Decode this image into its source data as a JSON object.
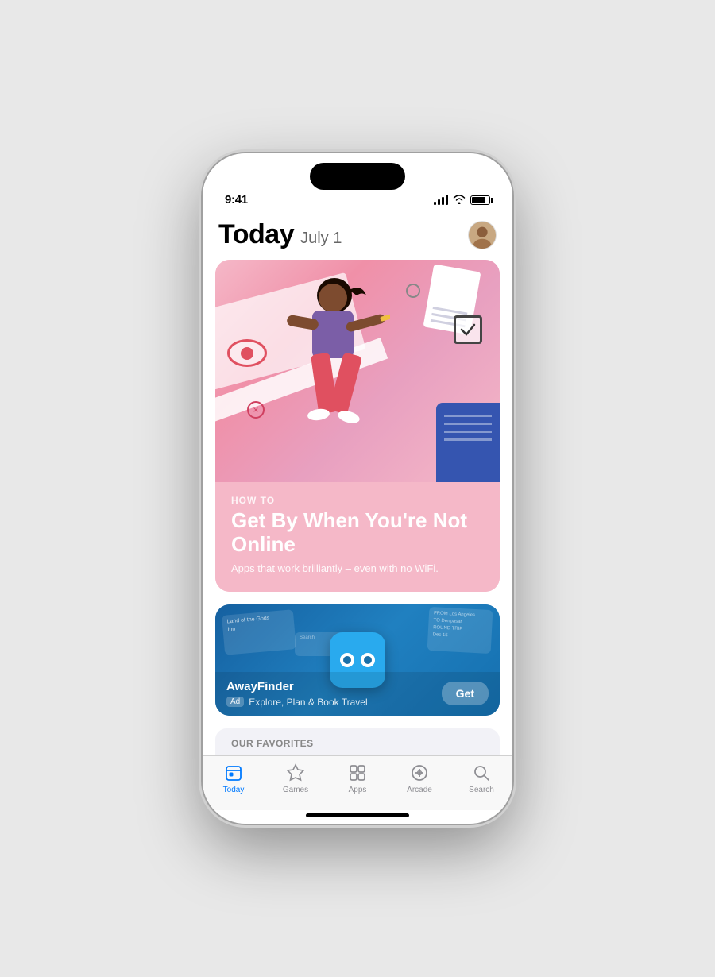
{
  "phone": {
    "status_bar": {
      "time": "9:41",
      "signal_label": "signal bars",
      "wifi_label": "wifi",
      "battery_label": "battery"
    },
    "header": {
      "title": "Today",
      "date": "July 1",
      "avatar_label": "user avatar"
    },
    "feature_card": {
      "eyebrow": "HOW TO",
      "title": "Get By When You're Not Online",
      "subtitle": "Apps that work brilliantly – even with no WiFi."
    },
    "ad_card": {
      "app_name": "AwayFinder",
      "ad_badge": "Ad",
      "tagline": "Explore, Plan & Book Travel",
      "get_button_label": "Get"
    },
    "favorites_section": {
      "title": "OUR FAVORITES"
    },
    "tab_bar": {
      "tabs": [
        {
          "id": "today",
          "label": "Today",
          "active": true
        },
        {
          "id": "games",
          "label": "Games",
          "active": false
        },
        {
          "id": "apps",
          "label": "Apps",
          "active": false
        },
        {
          "id": "arcade",
          "label": "Arcade",
          "active": false
        },
        {
          "id": "search",
          "label": "Search",
          "active": false
        }
      ]
    }
  }
}
